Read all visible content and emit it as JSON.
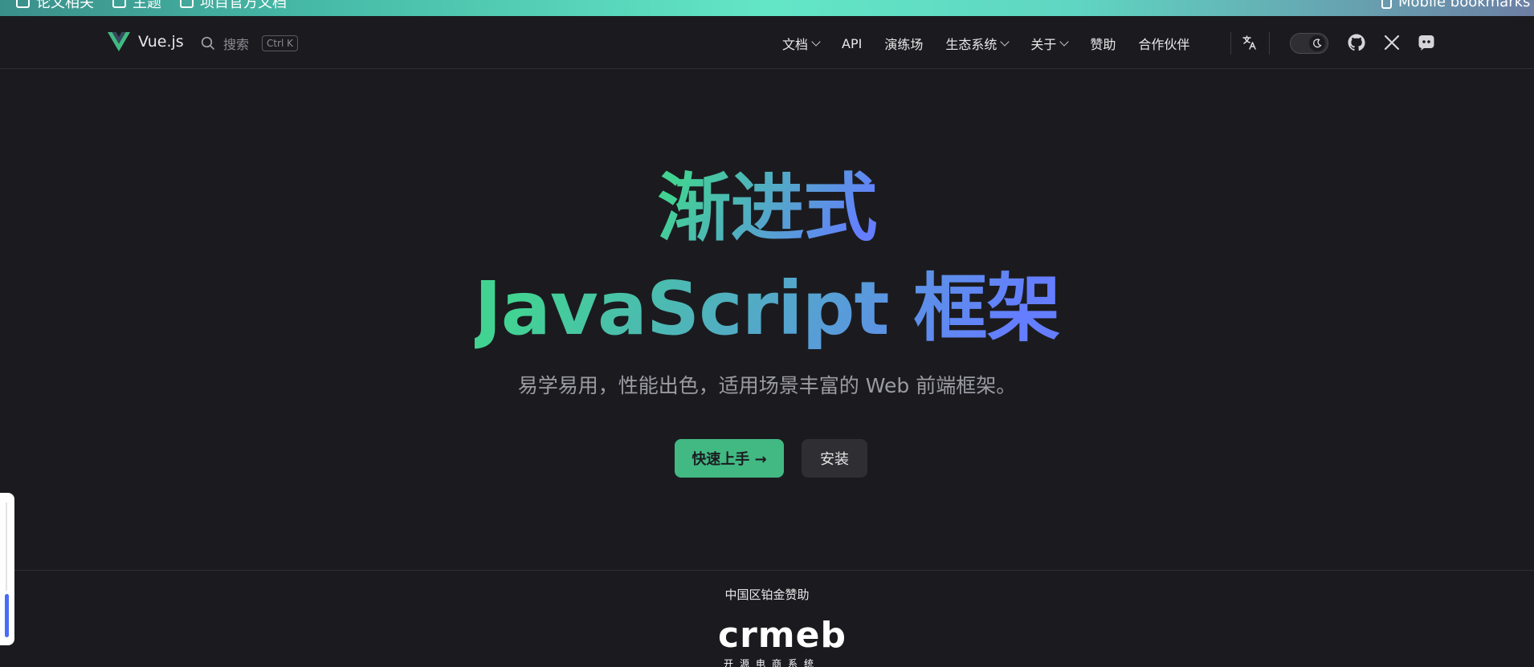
{
  "bookmarks": {
    "items": [
      "论文相关",
      "主题",
      "项目官方文档"
    ],
    "mobile": "Mobile bookmarks"
  },
  "nav": {
    "logo_text": "Vue.js",
    "search_label": "搜索",
    "search_shortcut": "Ctrl K",
    "menu": [
      {
        "label": "文档",
        "dropdown": true
      },
      {
        "label": "API",
        "dropdown": false
      },
      {
        "label": "演练场",
        "dropdown": false
      },
      {
        "label": "生态系统",
        "dropdown": true
      },
      {
        "label": "关于",
        "dropdown": true
      },
      {
        "label": "赞助",
        "dropdown": false
      },
      {
        "label": "合作伙伴",
        "dropdown": false
      }
    ],
    "icons": [
      "translate-icon",
      "moon-icon",
      "github-icon",
      "x-icon",
      "discord-icon"
    ]
  },
  "hero": {
    "title_line1": "渐进式",
    "title_line2": "JavaScript 框架",
    "tagline": "易学易用，性能出色，适用场景丰富的 Web 前端框架。",
    "primary_button": "快速上手 →",
    "secondary_button": "安装"
  },
  "sponsors": {
    "label": "中国区铂金赞助",
    "logo_word": "crmeb",
    "logo_sub": "开源电商系统"
  },
  "colors": {
    "background": "#1b1b1f",
    "brand": "#42b883",
    "gradient_start": "#42d392",
    "gradient_end": "#647eff"
  }
}
